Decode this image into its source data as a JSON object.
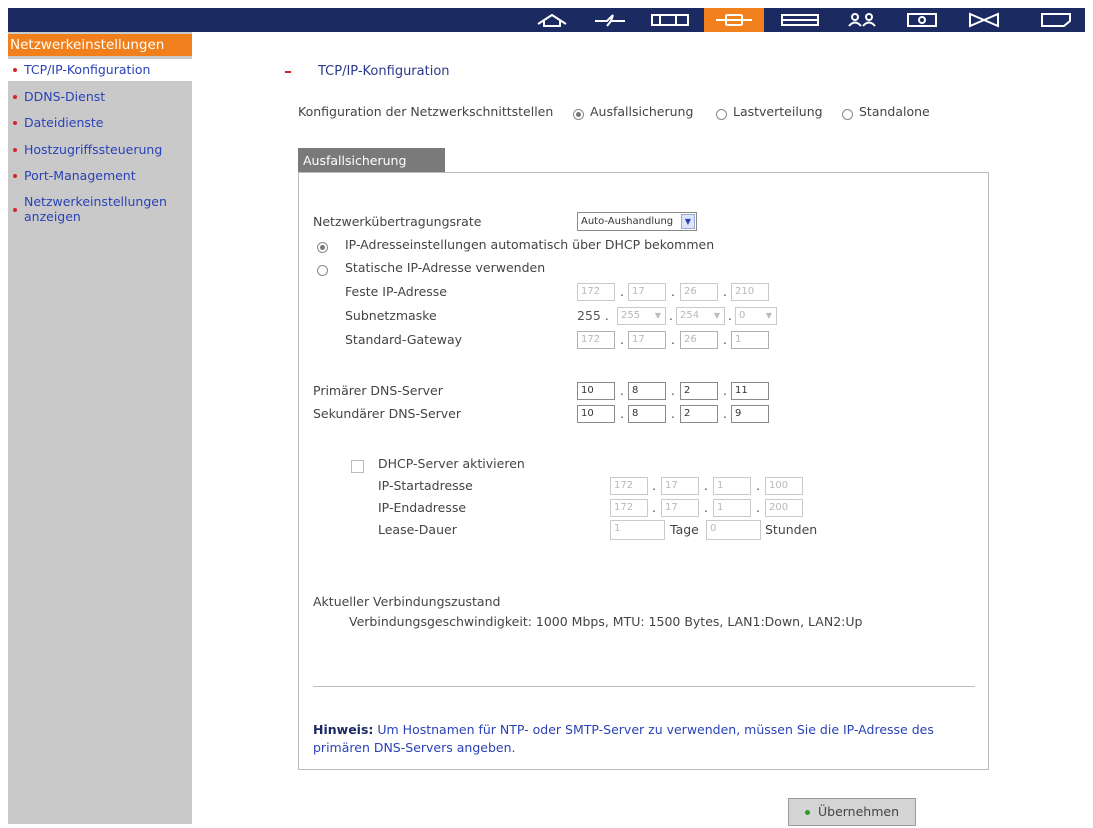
{
  "toolbar": {
    "icons": [
      "home-icon",
      "quick-config-icon",
      "system-settings-icon",
      "network-icon",
      "device-config-icon",
      "user-management-icon",
      "network-share-icon",
      "status-icon",
      "logout-icon"
    ],
    "active": "network-icon"
  },
  "sidebar": {
    "title": "Netzwerkeinstellungen",
    "items": [
      {
        "label": "TCP/IP-Konfiguration"
      },
      {
        "label": "DDNS-Dienst"
      },
      {
        "label": "Dateidienste"
      },
      {
        "label": "Hostzugriffssteuerung"
      },
      {
        "label": "Port-Management"
      },
      {
        "label": "Netzwerkeinstellungen anzeigen"
      }
    ]
  },
  "main": {
    "heading": "TCP/IP-Konfiguration",
    "interface_config_label": "Konfiguration der Netzwerkschnittstellen",
    "modes": [
      {
        "label": "Ausfallsicherung",
        "selected": true
      },
      {
        "label": "Lastverteilung",
        "selected": false
      },
      {
        "label": "Standalone",
        "selected": false
      }
    ],
    "tab_label": "Ausfallsicherung"
  },
  "form": {
    "rate_label": "Netzwerkübertragungsrate",
    "rate_value": "Auto-Aushandlung",
    "dhcp_option": "IP-Adresseinstellungen automatisch über DHCP bekommen",
    "static_option": "Statische IP-Adresse verwenden",
    "fixed_ip_label": "Feste IP-Adresse",
    "fixed_ip": [
      "172",
      "17",
      "26",
      "210"
    ],
    "subnet_label": "Subnetzmaske",
    "subnet_prefix": "255 .",
    "subnet": [
      "255",
      "254",
      "0"
    ],
    "gateway_label": "Standard-Gateway",
    "gateway": [
      "172",
      "17",
      "26",
      "1"
    ],
    "dns_primary_label": "Primärer DNS-Server",
    "dns_primary": [
      "10",
      "8",
      "2",
      "11"
    ],
    "dns_secondary_label": "Sekundärer DNS-Server",
    "dns_secondary": [
      "10",
      "8",
      "2",
      "9"
    ],
    "dhcp_server_label": "DHCP-Server aktivieren",
    "ip_start_label": "IP-Startadresse",
    "ip_start": [
      "172",
      "17",
      "1",
      "100"
    ],
    "ip_end_label": "IP-Endadresse",
    "ip_end": [
      "172",
      "17",
      "1",
      "200"
    ],
    "lease_label": "Lease-Dauer",
    "lease_days": "1",
    "days_label": "Tage",
    "lease_hours": "0",
    "hours_label": "Stunden"
  },
  "status": {
    "label": "Aktueller Verbindungszustand",
    "text": "Verbindungsgeschwindigkeit: 1000 Mbps, MTU: 1500 Bytes, LAN1:Down, LAN2:Up"
  },
  "hint": {
    "bold": "Hinweis:",
    "text": " Um Hostnamen für NTP- oder SMTP-Server zu verwenden, müssen Sie die IP-Adresse des primären DNS-Servers angeben."
  },
  "apply_button": "Übernehmen"
}
